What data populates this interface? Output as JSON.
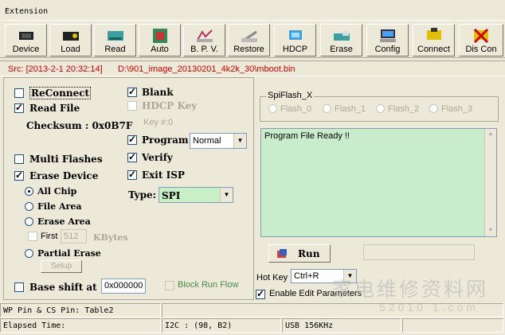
{
  "menu": {
    "extension": "Extension"
  },
  "toolbar": [
    {
      "label": "Device",
      "icon": "chip-icon"
    },
    {
      "label": "Load",
      "icon": "chip-load-icon"
    },
    {
      "label": "Read",
      "icon": "read-icon"
    },
    {
      "label": "Auto",
      "icon": "auto-icon"
    },
    {
      "label": "B. P. V.",
      "icon": "bpv-icon"
    },
    {
      "label": "Restore",
      "icon": "restore-icon"
    },
    {
      "label": "HDCP",
      "icon": "hdcp-icon"
    },
    {
      "label": "Erase",
      "icon": "erase-icon"
    },
    {
      "label": "Config",
      "icon": "config-icon"
    },
    {
      "label": "Connect",
      "icon": "connect-icon"
    },
    {
      "label": "Dis Con",
      "icon": "disconnect-icon"
    }
  ],
  "src": {
    "label": "Src: [2013-2-1 20:32:14]",
    "path": "D:\\901_image_20130201_4k2k_30\\mboot.bin"
  },
  "options": {
    "reconnect": "ReConnect",
    "read_file": "Read File",
    "checksum": "Checksum : 0x0B7F",
    "multi_flashes": "Multi Flashes",
    "erase_device": "Erase Device",
    "all_chip": "All Chip",
    "file_area": "File Area",
    "erase_area": "Erase Area",
    "first": "First",
    "first_value": "512",
    "kbytes": "KBytes",
    "partial_erase": "Partial Erase",
    "setup": "Setup",
    "base_shift": "Base shift at",
    "base_shift_value": "0x000000",
    "block_run_flow": "Block Run Flow",
    "blank": "Blank",
    "hdcp_key": "HDCP Key",
    "key_num": "Key #:0",
    "program": "Program",
    "program_mode": "Normal",
    "verify": "Verify",
    "exit_isp": "Exit ISP",
    "type_label": "Type:",
    "type_value": "SPI"
  },
  "spiflash": {
    "title": "SpiFlash_X",
    "options": [
      "Flash_0",
      "Flash_1",
      "Flash_2",
      "Flash_3"
    ]
  },
  "log": {
    "text": "Program File Ready !!"
  },
  "run": {
    "label": "Run"
  },
  "hotkey": {
    "label": "Hot Key",
    "value": "Ctrl+R"
  },
  "enable_edit": "Enable Edit Parameters",
  "watermark": {
    "text": "家电维修资料网",
    "url": "52010 1.com"
  },
  "status": {
    "wp_pin": "WP Pin & CS Pin: Table2",
    "elapsed": "Elapsed Time:",
    "i2c": "I2C :  (98, B2)",
    "usb": "USB  156KHz"
  }
}
